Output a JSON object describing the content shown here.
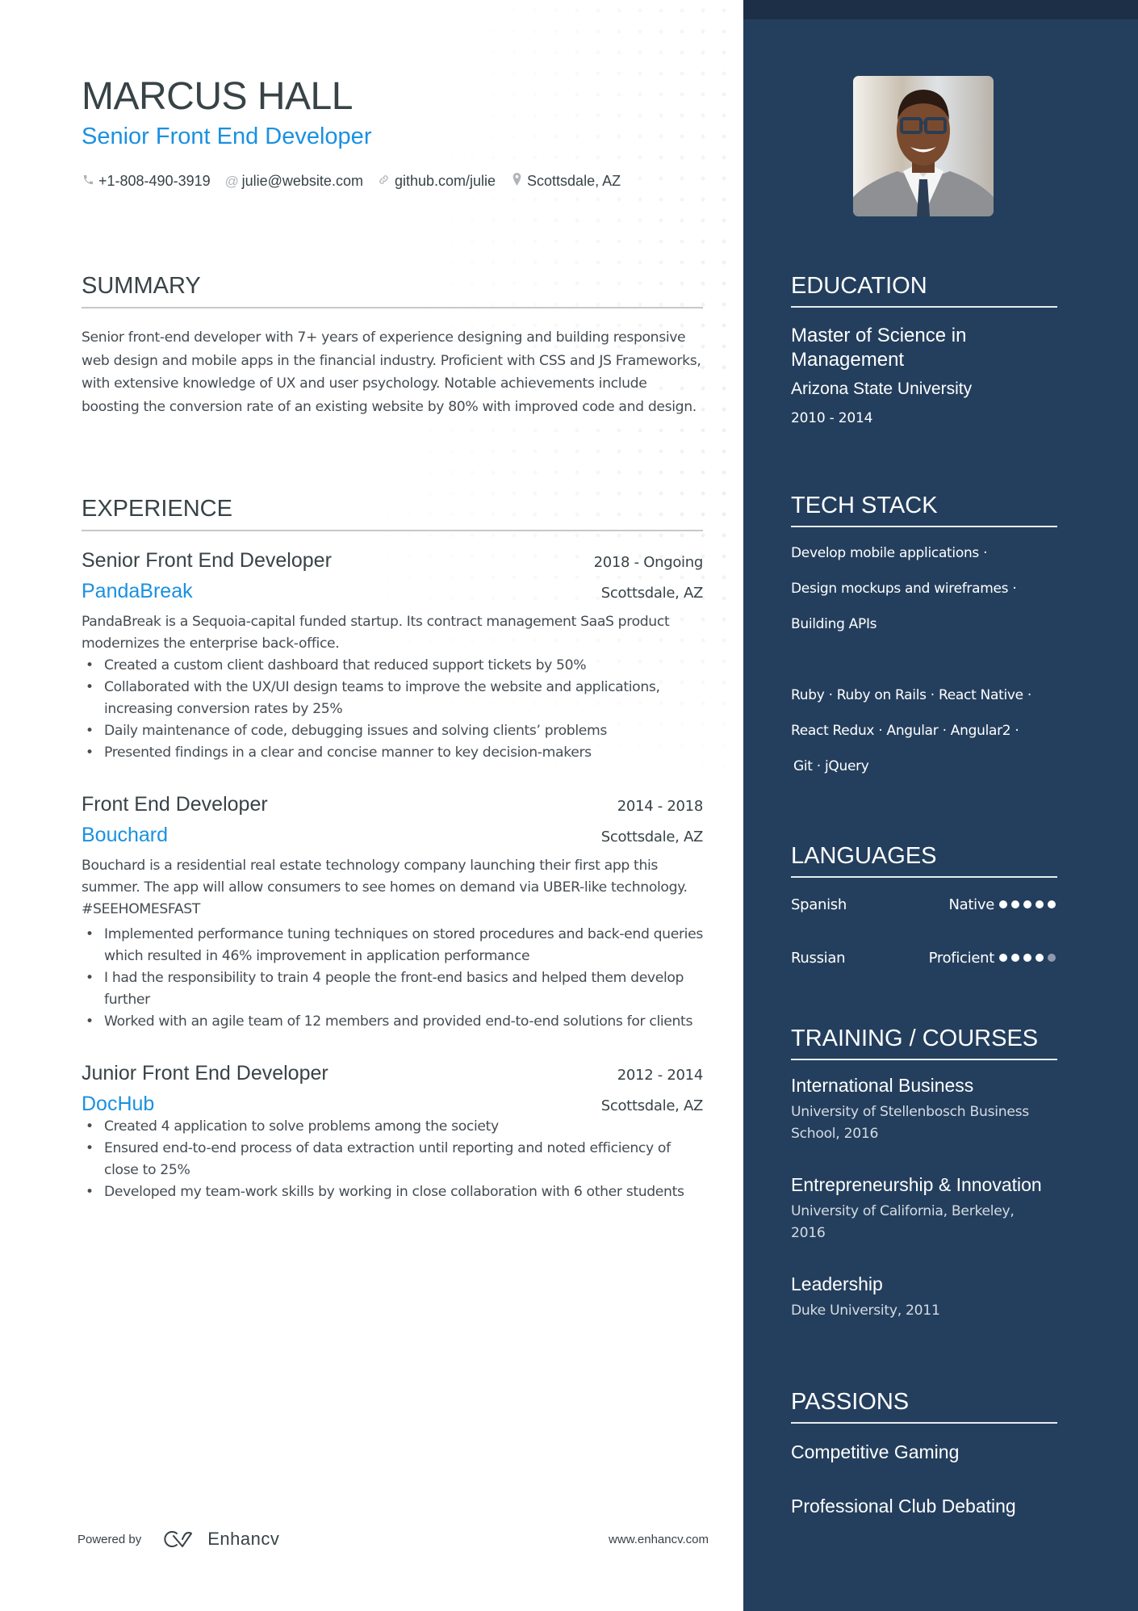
{
  "header": {
    "name": "MARCUS HALL",
    "headline": "Senior Front End Developer",
    "contacts": [
      {
        "icon": "phone-icon",
        "glyph": "✆",
        "text": "+1-808-490-3919"
      },
      {
        "icon": "at-icon",
        "glyph": "@",
        "text": "julie@website.com"
      },
      {
        "icon": "link-icon",
        "glyph": "∞",
        "text": "github.com/julie"
      },
      {
        "icon": "location-pin-icon",
        "glyph": "⚲",
        "text": "Scottsdale, AZ"
      }
    ]
  },
  "summary": {
    "title": "SUMMARY",
    "text": "Senior front-end developer with 7+ years of experience designing and building responsive web design and mobile apps in the financial industry. Proficient with CSS and JS Frameworks, with extensive knowledge of UX and user psychology. Notable achievements include boosting the conversion rate of an existing website by 80% with improved code and design."
  },
  "experience": {
    "title": "EXPERIENCE",
    "jobs": [
      {
        "title": "Senior Front End Developer",
        "dates": "2018 - Ongoing",
        "company": "PandaBreak",
        "location": "Scottsdale, AZ",
        "description": "PandaBreak is a Sequoia-capital funded startup. Its contract management SaaS product modernizes the enterprise back-office.",
        "bullets": [
          "Created a custom client dashboard that reduced support tickets by 50%",
          "Collaborated with the UX/UI design teams to improve the website and applications, increasing conversion rates by 25%",
          "Daily maintenance of code, debugging issues and solving clients’ problems",
          "Presented findings in a clear and concise manner to key decision-makers"
        ]
      },
      {
        "title": "Front End Developer",
        "dates": "2014 - 2018",
        "company": "Bouchard",
        "location": "Scottsdale, AZ",
        "description": "Bouchard is a residential real estate technology company launching their first app this summer. The app will allow consumers to see homes on demand via UBER-like technology. #SEEHOMESFAST",
        "bullets": [
          "Implemented performance tuning techniques on stored procedures and back-end queries which resulted in 46% improvement in application performance",
          "I had the responsibility to train 4 people the front-end basics and helped them develop further",
          "Worked with an agile team of 12 members and provided end-to-end solutions for clients"
        ]
      },
      {
        "title": "Junior Front End Developer",
        "dates": "2012 - 2014",
        "company": "DocHub",
        "location": "Scottsdale, AZ",
        "description": "",
        "bullets": [
          "Created 4 application to solve problems among the society",
          "Ensured end-to-end process of data extraction until reporting and noted efficiency of close to 25%",
          "Developed my team-work skills by working in close collaboration with 6 other students"
        ]
      }
    ]
  },
  "footer": {
    "powered_by": "Powered by",
    "brand": "Enhancv",
    "website": "www.enhancv.com"
  },
  "sidebar": {
    "photo_alt": "Profile photo",
    "education": {
      "title": "EDUCATION",
      "degree": "Master of Science in Management",
      "school": "Arizona State University",
      "years": "2010 - 2014"
    },
    "tech_stack": {
      "title": "TECH STACK",
      "lines": [
        "Develop mobile applications ·",
        "Design mockups and wireframes ·",
        "Building APIs",
        "",
        "Ruby · Ruby on Rails · React Native ·",
        "React Redux · Angular · Angular2 ·",
        " Git · jQuery"
      ]
    },
    "languages": {
      "title": "LANGUAGES",
      "items": [
        {
          "name": "Spanish",
          "level": "Native",
          "rating": 5,
          "max": 5
        },
        {
          "name": "Russian",
          "level": "Proficient",
          "rating": 4,
          "max": 5
        }
      ]
    },
    "training": {
      "title": "TRAINING / COURSES",
      "items": [
        {
          "title": "International Business",
          "sub": "University of Stellenbosch Business School, 2016"
        },
        {
          "title": "Entrepreneurship & Innovation",
          "sub": "University of California, Berkeley, 2016"
        },
        {
          "title": "Leadership",
          "sub": "Duke University, 2011"
        }
      ]
    },
    "passions": {
      "title": "PASSIONS",
      "items": [
        "Competitive Gaming",
        "Professional Club Debating"
      ]
    },
    "colors": {
      "accent": "#1a91e0",
      "sidebar": "#243f5d",
      "sidebar_top": "#1c2f46",
      "text": "#384347"
    }
  }
}
